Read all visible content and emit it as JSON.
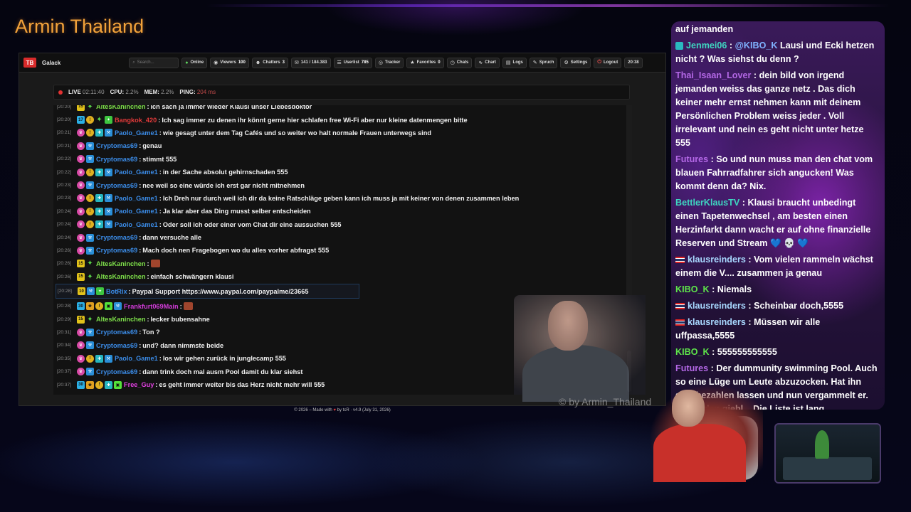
{
  "channel": {
    "title": "Armin Thailand"
  },
  "app": {
    "name": "Galack",
    "logo_text": "TB",
    "search_placeholder": "Search...",
    "nav": [
      {
        "icon": "●",
        "label": "Online",
        "count": ""
      },
      {
        "icon": "◉",
        "label": "Viewers",
        "count": "100"
      },
      {
        "icon": "☻",
        "label": "Chatters",
        "count": "3"
      },
      {
        "icon": "✉",
        "label": "141 / 184.383",
        "count": ""
      },
      {
        "icon": "☰",
        "label": "Userlist",
        "count": "785"
      },
      {
        "icon": "◎",
        "label": "Tracker",
        "count": ""
      },
      {
        "icon": "★",
        "label": "Favorites",
        "count": "0"
      },
      {
        "icon": "◷",
        "label": "Chats",
        "count": ""
      },
      {
        "icon": "∿",
        "label": "Chart",
        "count": ""
      },
      {
        "icon": "▤",
        "label": "Logs",
        "count": ""
      },
      {
        "icon": "✎",
        "label": "Spruch",
        "count": ""
      },
      {
        "icon": "⚙",
        "label": "Settings",
        "count": ""
      },
      {
        "icon": "⏻",
        "label": "Logout",
        "count": ""
      },
      {
        "icon": "",
        "label": "20:38",
        "count": ""
      }
    ],
    "status": {
      "live_label": "LIVE",
      "live_time": "02:11:40",
      "cpu_label": "CPU:",
      "cpu_val": "2.2%",
      "mem_label": "MEM:",
      "mem_val": "2.2%",
      "ping_label": "PING:",
      "ping_val": "204 ms"
    },
    "footer": {
      "pre": "© 2026 – Made with",
      "heart": "♥",
      "post": "by tcR · v4.9 (July 31, 2026)"
    },
    "watermark": "© by Armin_Thailand"
  },
  "chat": [
    {
      "ts": "[20:20]",
      "badges": [
        "num:15",
        "green-star"
      ],
      "user": "AltesKaninchen",
      "ucls": "u-altes",
      "text": "Ich sach ja immer wieder Klausi unser Liebesdoktor"
    },
    {
      "ts": "[20:20]",
      "badges": [
        "num-blue:17",
        "gold",
        "green-star",
        "green"
      ],
      "user": "Bangkok_420",
      "ucls": "u-bangkok",
      "text": "Ich sag immer zu denen ihr könnt gerne hier schlafen free Wi-Fi aber nur kleine datenmengen bitte"
    },
    {
      "ts": "[20:21]",
      "badges": [
        "pink",
        "gold",
        "teal",
        "blue"
      ],
      "user": "Paolo_Game1",
      "ucls": "u-paolo",
      "text": "wie gesagt unter dem Tag Cafés und so weiter wo halt normale Frauen unterwegs sind"
    },
    {
      "ts": "[20:21]",
      "badges": [
        "pink",
        "blue"
      ],
      "user": "Cryptomas69",
      "ucls": "u-crypto",
      "text": "genau"
    },
    {
      "ts": "[20:22]",
      "badges": [
        "pink",
        "blue"
      ],
      "user": "Cryptomas69",
      "ucls": "u-crypto",
      "text": "stimmt 555"
    },
    {
      "ts": "[20:22]",
      "badges": [
        "pink",
        "gold",
        "teal",
        "blue"
      ],
      "user": "Paolo_Game1",
      "ucls": "u-paolo",
      "text": "in der Sache absolut gehirnschaden 555"
    },
    {
      "ts": "[20:23]",
      "badges": [
        "pink",
        "blue"
      ],
      "user": "Cryptomas69",
      "ucls": "u-crypto",
      "text": "nee weil so eine würde ich erst gar nicht mitnehmen"
    },
    {
      "ts": "[20:23]",
      "badges": [
        "pink",
        "gold",
        "teal",
        "blue"
      ],
      "user": "Paolo_Game1",
      "ucls": "u-paolo",
      "text": "Ich Dreh nur durch weil ich dir da keine Ratschläge geben kann ich muss ja mit keiner von denen zusammen leben"
    },
    {
      "ts": "[20:24]",
      "badges": [
        "pink",
        "gold",
        "teal",
        "blue"
      ],
      "user": "Paolo_Game1",
      "ucls": "u-paolo",
      "text": "Ja klar aber das Ding musst selber entscheiden"
    },
    {
      "ts": "[20:24]",
      "badges": [
        "pink",
        "gold",
        "teal",
        "blue"
      ],
      "user": "Paolo_Game1",
      "ucls": "u-paolo",
      "text": "Oder soll ich oder einer vom Chat dir eine aussuchen 555"
    },
    {
      "ts": "[20:24]",
      "badges": [
        "pink",
        "blue"
      ],
      "user": "Cryptomas69",
      "ucls": "u-crypto",
      "text": "dann versuche alle"
    },
    {
      "ts": "[20:26]",
      "badges": [
        "pink",
        "blue"
      ],
      "user": "Cryptomas69",
      "ucls": "u-crypto",
      "text": "Mach doch nen Fragebogen wo du alles vorher abfragst 555"
    },
    {
      "ts": "[20:26]",
      "badges": [
        "num:15",
        "green-star"
      ],
      "user": "AltesKaninchen",
      "ucls": "u-altes",
      "text": "",
      "emote": true
    },
    {
      "ts": "[20:26]",
      "badges": [
        "num:15",
        "green-star"
      ],
      "user": "AltesKaninchen",
      "ucls": "u-altes",
      "text": "einfach schwängern klausi"
    },
    {
      "ts": "[20:28]",
      "badges": [
        "num:10",
        "blue",
        "green"
      ],
      "user": "BotRix",
      "ucls": "u-botrix",
      "text": "Paypal Support https://www.paypal.com/paypalme/23665",
      "hl": true
    },
    {
      "ts": "[20:28]",
      "badges": [
        "num-blue:30",
        "crown",
        "gold",
        "lime",
        "blue"
      ],
      "user": "Frankfurt069Main",
      "ucls": "u-frank",
      "text": "",
      "emote": true
    },
    {
      "ts": "[20:29]",
      "badges": [
        "num:15",
        "green-star"
      ],
      "user": "AltesKaninchen",
      "ucls": "u-altes",
      "text": "lecker bubensahne"
    },
    {
      "ts": "[20:31]",
      "badges": [
        "pink",
        "blue"
      ],
      "user": "Cryptomas69",
      "ucls": "u-crypto",
      "text": "Ton ?"
    },
    {
      "ts": "[20:34]",
      "badges": [
        "pink",
        "blue"
      ],
      "user": "Cryptomas69",
      "ucls": "u-crypto",
      "text": "und? dann nimmste beide"
    },
    {
      "ts": "[20:35]",
      "badges": [
        "pink",
        "gold",
        "teal",
        "blue"
      ],
      "user": "Paolo_Game1",
      "ucls": "u-paolo",
      "text": "los wir gehen zurück in junglecamp 555"
    },
    {
      "ts": "[20:37]",
      "badges": [
        "pink",
        "blue"
      ],
      "user": "Cryptomas69",
      "ucls": "u-crypto",
      "text": "dann trink doch mal ausm Pool damit du klar siehst"
    },
    {
      "ts": "[20:37]",
      "badges": [
        "num-blue:30",
        "crown",
        "gold",
        "teal",
        "lime"
      ],
      "user": "Free_Guy",
      "ucls": "u-free",
      "text": "es geht immer weiter bis das Herz nicht mehr will 555"
    }
  ],
  "overlay_chat": [
    {
      "prefix": "",
      "user": "",
      "ucls": "",
      "text": "auf jemanden"
    },
    {
      "prefix": "badge",
      "user": "Jenmei06",
      "ucls": "ov-user-teal",
      "mention": "@KIBO_K",
      "text": "Lausi und Ecki hetzen nicht ? Was siehst du denn ?"
    },
    {
      "prefix": "",
      "user": "Thai_Isaan_Lover",
      "ucls": "ov-user-purple",
      "text": "dein bild von irgend jemanden weiss das ganze netz . Das dich keiner mehr ernst nehmen kann mit deinem Persönlichen Problem weiss jeder . Voll irrelevant und nein es geht nicht unter hetze 555"
    },
    {
      "prefix": "",
      "user": "Futures",
      "ucls": "ov-user-purple",
      "text": "So und nun muss man den chat vom blauen Fahrradfahrer sich angucken! Was kommt denn da? Nix."
    },
    {
      "prefix": "",
      "user": "BettlerKlausTV",
      "ucls": "ov-user-teal",
      "text": "Klausi braucht unbedingt einen Tapetenwechsel , am besten einen Herzinfarkt dann wacht er auf ohne finanzielle Reserven und Stream 💙 💀 💙"
    },
    {
      "prefix": "flag",
      "user": "klausreinders",
      "ucls": "ov-user-lightblue",
      "text": "Vom vielen rammeln wächst einem die V.... zusammen ja genau"
    },
    {
      "prefix": "",
      "user": "KIBO_K",
      "ucls": "ov-user-green",
      "text": "Niemals"
    },
    {
      "prefix": "flag",
      "user": "klausreinders",
      "ucls": "ov-user-lightblue",
      "text": "Scheinbar doch,5555"
    },
    {
      "prefix": "flag",
      "user": "klausreinders",
      "ucls": "ov-user-lightblue",
      "text": "Müssen wir alle uffpassa,5555"
    },
    {
      "prefix": "",
      "user": "KIBO_K",
      "ucls": "ov-user-green",
      "text": "555555555555"
    },
    {
      "prefix": "",
      "user": "Futures",
      "ucls": "ov-user-purple",
      "text": "Der dummunity swimming Pool. Auch so eine Lüge um Leute abzuzocken. Hat ihn sich bezahlen lassen und nun vergammelt er. Sowie den giebl... Die Liste ist lang."
    }
  ]
}
